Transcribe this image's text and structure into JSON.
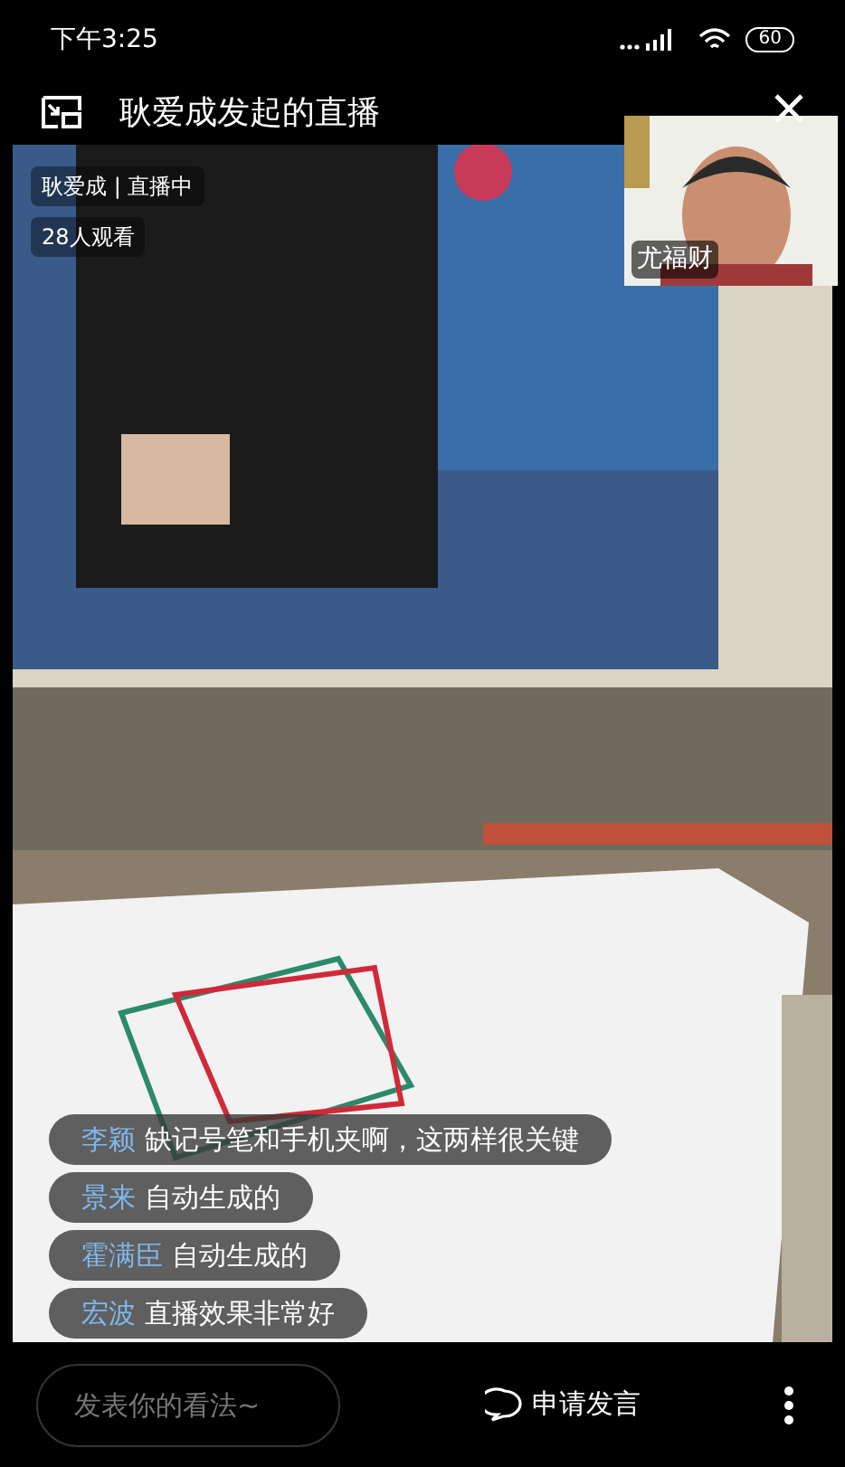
{
  "status_bar": {
    "time": "下午3:25",
    "battery": "60"
  },
  "header": {
    "title": "耿爱成发起的直播"
  },
  "stream": {
    "host_tag": "耿爱成 | 直播中",
    "viewers": "28人观看"
  },
  "guest_video": {
    "name": "尤福财"
  },
  "comments": [
    {
      "user": "李颖",
      "text": "缺记号笔和手机夹啊，这两样很关键"
    },
    {
      "user": "景来",
      "text": "自动生成的"
    },
    {
      "user": "霍满臣",
      "text": "自动生成的"
    },
    {
      "user": "宏波",
      "text": "直播效果非常好"
    }
  ],
  "bottom_bar": {
    "comment_placeholder": "发表你的看法~",
    "speak_button": "申请发言"
  }
}
